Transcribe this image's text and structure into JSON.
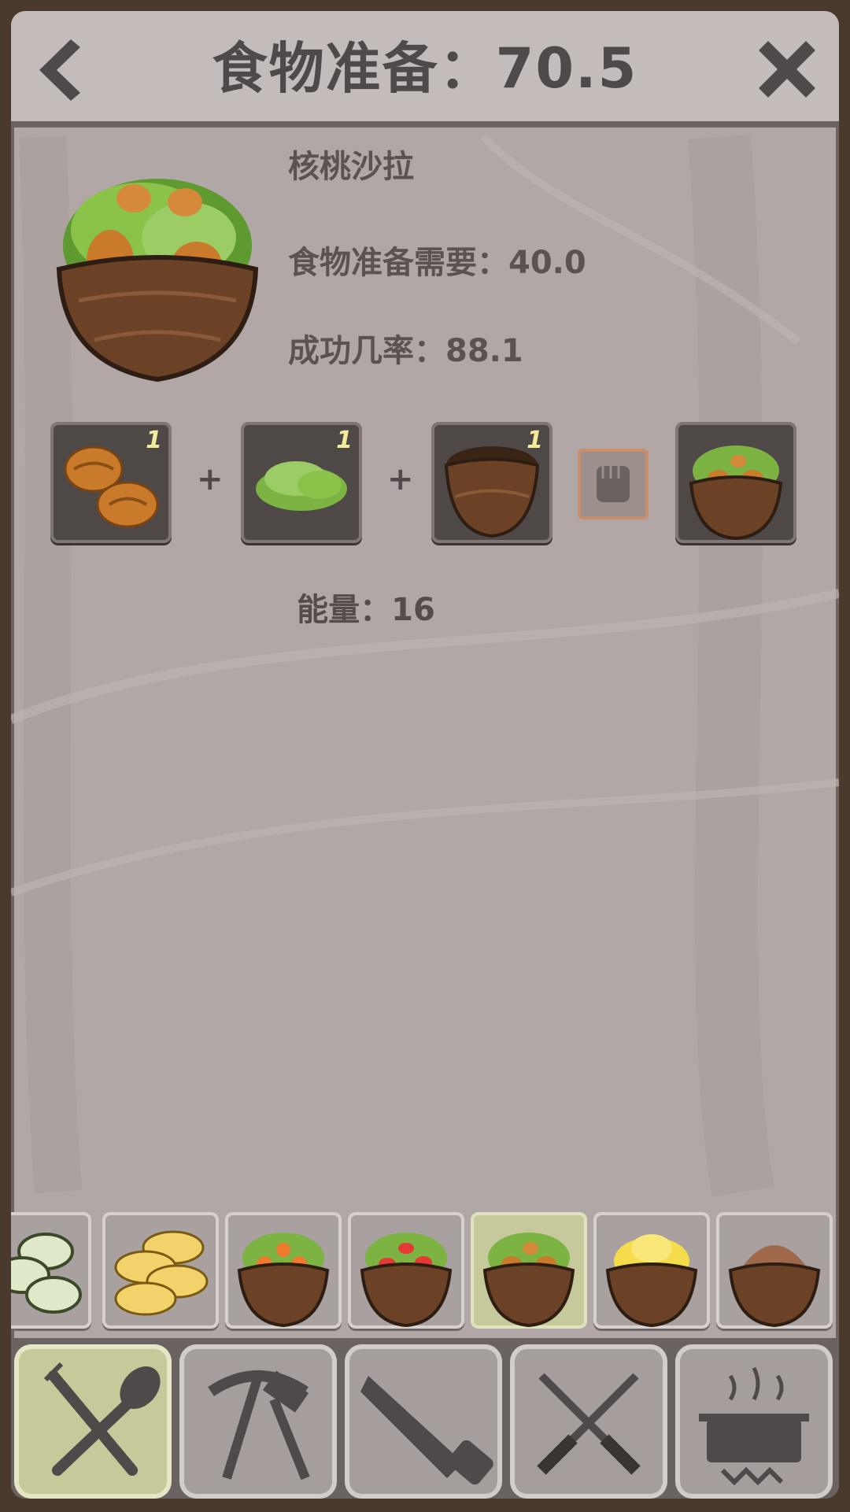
{
  "header": {
    "title": "食物准备：70.5"
  },
  "recipe": {
    "name": "核桃沙拉",
    "requirement": "食物准备需要：40.0",
    "success_rate": "成功几率：88.1",
    "energy": "能量：16"
  },
  "ingredients": [
    {
      "icon": "walnut-icon",
      "qty": "1"
    },
    {
      "icon": "lettuce-icon",
      "qty": "1"
    },
    {
      "icon": "coconut-bowl-icon",
      "qty": "1"
    }
  ],
  "result_icon": "walnut-salad-icon",
  "plus_sign": "+",
  "recipe_list": [
    {
      "icon": "cucumber-slices-icon",
      "selected": false
    },
    {
      "icon": "banana-slices-icon",
      "selected": false
    },
    {
      "icon": "carrot-salad-icon",
      "selected": false
    },
    {
      "icon": "tomato-salad-icon",
      "selected": false
    },
    {
      "icon": "walnut-salad-icon",
      "selected": true
    },
    {
      "icon": "mashed-banana-icon",
      "selected": false
    },
    {
      "icon": "cocoa-bowl-icon",
      "selected": false
    }
  ],
  "tabs": [
    {
      "icon": "fork-spoon-icon",
      "active": true
    },
    {
      "icon": "pickaxe-hammer-icon",
      "active": false
    },
    {
      "icon": "saw-icon",
      "active": false
    },
    {
      "icon": "knives-icon",
      "active": false
    },
    {
      "icon": "cooking-pot-icon",
      "active": false
    }
  ],
  "colors": {
    "panel": "#b1a7a6",
    "title_text": "#4f4949",
    "selected": "#c6c99a",
    "slot": "#4e4847",
    "qty_text": "#f2ec9a"
  }
}
